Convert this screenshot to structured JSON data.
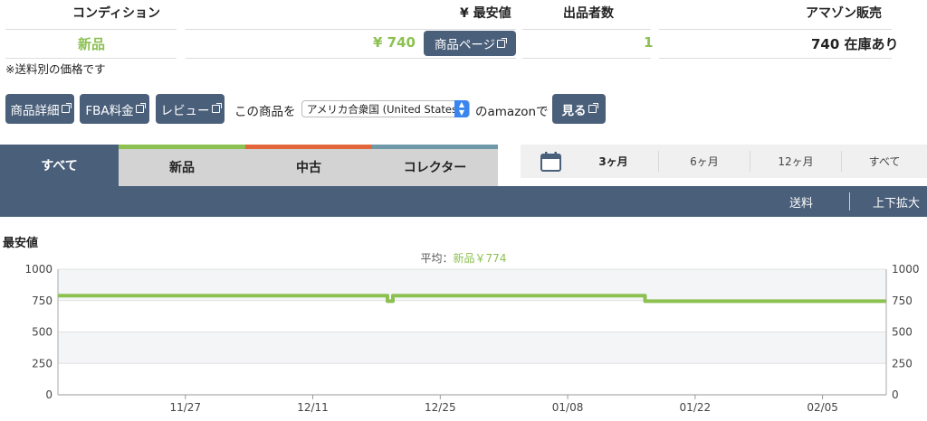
{
  "table": {
    "headers": {
      "condition": "コンディション",
      "lowest": "¥ 最安値",
      "sellers": "出品者数",
      "amazon": "アマゾン販売"
    },
    "row": {
      "condition": "新品",
      "price": "¥ 740",
      "page_button": "商品ページ",
      "sellers": "1",
      "amazon": "740 在庫あり"
    },
    "note": "※送料別の価格です"
  },
  "actions": {
    "detail": "商品詳細",
    "fba": "FBA料金",
    "review": "レビュー",
    "label": "この商品を",
    "country": "アメリカ合衆国 (United States)",
    "suffix": "のamazonで",
    "view": "見る"
  },
  "tabs": {
    "all": "すべて",
    "new": "新品",
    "used": "中古",
    "collector": "コレクター"
  },
  "periods": {
    "p3": "3ヶ月",
    "p6": "6ヶ月",
    "p12": "12ヶ月",
    "all": "すべて"
  },
  "toolbar": {
    "shipping": "送料",
    "zoom": "上下拡大"
  },
  "chart_title": "最安値",
  "chart_avg": {
    "prefix": "平均：",
    "value": "新品￥774"
  },
  "colors": {
    "new": "#8cc152",
    "used": "#e2683c",
    "collector": "#6f99a9",
    "dark": "#4a5f7a"
  },
  "chart_data": {
    "type": "line",
    "title": "最安値",
    "ylim": [
      0,
      1000
    ],
    "yticks": [
      "0",
      "250",
      "500",
      "750",
      "1000"
    ],
    "xticks": [
      "11/27",
      "12/11",
      "12/25",
      "01/08",
      "01/22",
      "02/05"
    ],
    "xtick_days": [
      14,
      28,
      42,
      56,
      70,
      84
    ],
    "xlim_days": [
      0,
      91
    ],
    "series": [
      {
        "name": "新品",
        "points": [
          [
            0,
            790
          ],
          [
            36.2,
            790
          ],
          [
            36.2,
            745
          ],
          [
            36.8,
            745
          ],
          [
            36.8,
            790
          ],
          [
            64.5,
            790
          ],
          [
            64.5,
            745
          ],
          [
            91,
            745
          ]
        ]
      }
    ]
  }
}
